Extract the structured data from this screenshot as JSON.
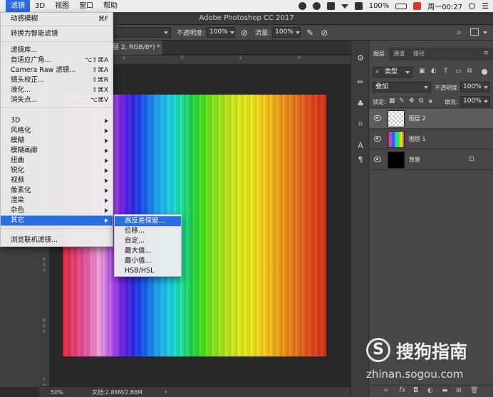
{
  "menubar": {
    "items": [
      "滤镜",
      "3D",
      "视图",
      "窗口",
      "帮助"
    ],
    "battery": "100%",
    "clock": "周一00:27"
  },
  "window": {
    "title": "Adobe Photoshop CC 2017"
  },
  "options": {
    "opacity_label": "不透明度:",
    "opacity_value": "100%",
    "flow_label": "流量:",
    "flow_value": "100%"
  },
  "document": {
    "tab_label": "层 2, RGB/8*) *",
    "zoom": "50%",
    "doc_info": "文档:2.86M/2.86M"
  },
  "ruler": {
    "top_labels": [
      "0",
      "5",
      "0",
      "5",
      "0"
    ],
    "left_labels": [
      "6",
      "0",
      "0",
      "6",
      "5",
      "0",
      "7",
      "0",
      "0"
    ]
  },
  "filter_menu": {
    "items": [
      {
        "label": "动感模糊",
        "shortcut": "⌘F"
      },
      {
        "label": "转换为智能滤镜",
        "shortcut": ""
      },
      {
        "label": "滤镜库...",
        "shortcut": ""
      },
      {
        "label": "自适应广角...",
        "shortcut": "⌥⇧⌘A"
      },
      {
        "label": "Camera Raw 滤镜...",
        "shortcut": "⇧⌘A"
      },
      {
        "label": "镜头校正...",
        "shortcut": "⇧⌘R"
      },
      {
        "label": "液化...",
        "shortcut": "⇧⌘X"
      },
      {
        "label": "消失点...",
        "shortcut": "⌥⌘V"
      },
      {
        "label": "3D",
        "shortcut": ""
      },
      {
        "label": "风格化",
        "shortcut": ""
      },
      {
        "label": "模糊",
        "shortcut": ""
      },
      {
        "label": "模糊画廊",
        "shortcut": ""
      },
      {
        "label": "扭曲",
        "shortcut": ""
      },
      {
        "label": "锐化",
        "shortcut": ""
      },
      {
        "label": "视频",
        "shortcut": ""
      },
      {
        "label": "像素化",
        "shortcut": ""
      },
      {
        "label": "渲染",
        "shortcut": ""
      },
      {
        "label": "杂色",
        "shortcut": ""
      },
      {
        "label": "其它",
        "shortcut": ""
      },
      {
        "label": "浏览联机滤镜...",
        "shortcut": ""
      }
    ]
  },
  "submenu": {
    "items": [
      "高反差保留...",
      "位移...",
      "自定...",
      "最大值...",
      "最小值...",
      "HSB/HSL"
    ]
  },
  "layers_panel": {
    "tabs": [
      "图层",
      "通道",
      "路径"
    ],
    "kind_filter": "类型",
    "blend_mode": "叠加",
    "opacity_label": "不透明度:",
    "opacity_value": "100%",
    "lock_label": "锁定:",
    "fill_label": "填充:",
    "fill_value": "100%",
    "layers": [
      {
        "name": "图层 2",
        "selected": true
      },
      {
        "name": "图层 1",
        "selected": false
      },
      {
        "name": "背景",
        "selected": false
      }
    ]
  },
  "watermark": {
    "brand": "搜狗指南",
    "url": "zhinan.sogou.com"
  },
  "colors": {
    "menu_highlight": "#2a6ce3",
    "panel_bg": "#474747",
    "canvas_bg": "#282828"
  }
}
